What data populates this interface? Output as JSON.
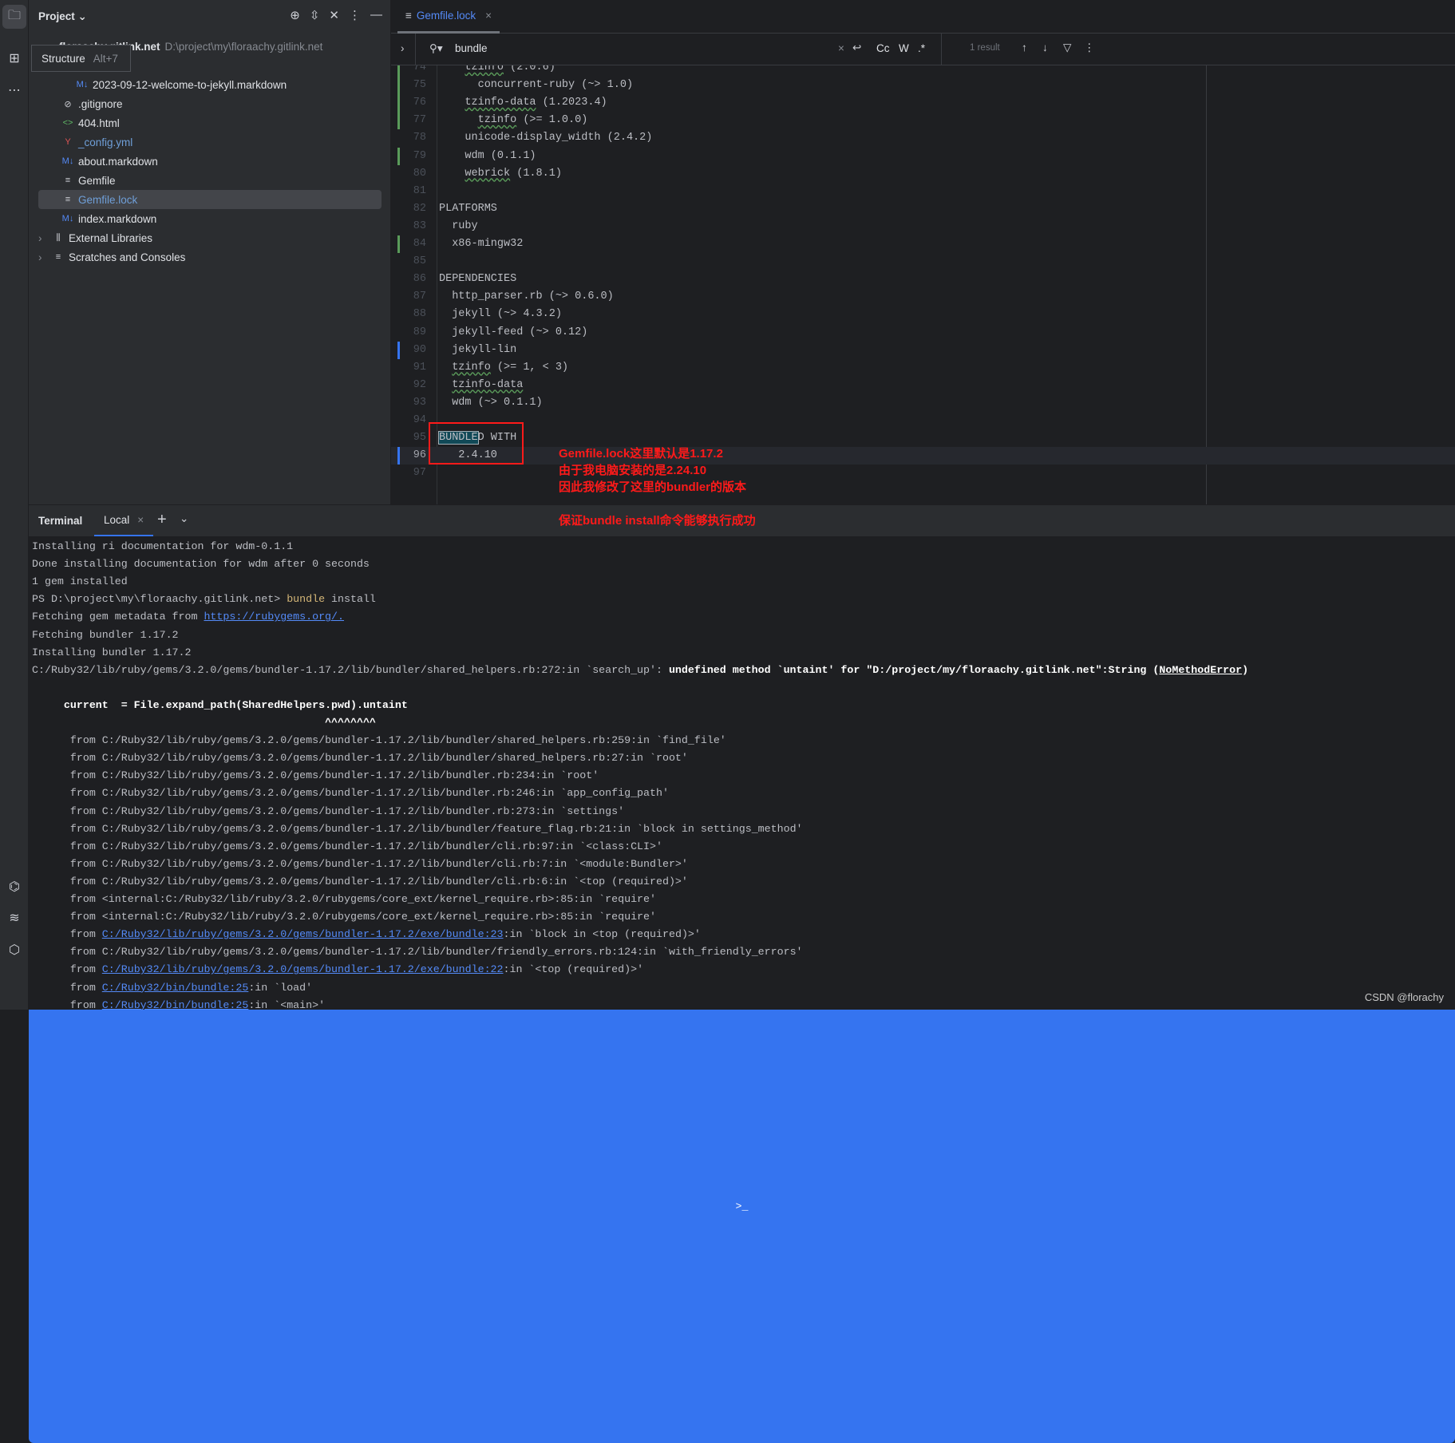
{
  "sidebar_strip": {
    "top": [
      {
        "icon": "folder-icon"
      },
      {
        "icon": "structure-icon"
      },
      {
        "icon": "more-icon"
      }
    ],
    "bottom": [
      {
        "icon": "python-icon"
      },
      {
        "icon": "layers-icon"
      },
      {
        "icon": "run-icon"
      },
      {
        "icon": "terminal-icon"
      }
    ]
  },
  "tooltip": {
    "label": "Structure",
    "shortcut": "Alt+7"
  },
  "project": {
    "title": "Project",
    "root": {
      "name": "floraachy.gitlink.net",
      "path": "D:\\project\\my\\floraachy.gitlink.net"
    },
    "items": [
      {
        "label": "2023-09-12-welcome-to-jekyll.markdown",
        "icon": "M↓",
        "indent": 3,
        "color": "#dfe1e5"
      },
      {
        "label": ".gitignore",
        "icon": "⊘",
        "indent": 2,
        "color": "#dfe1e5"
      },
      {
        "label": "404.html",
        "icon": "<>",
        "indent": 2,
        "color": "#dfe1e5"
      },
      {
        "label": "_config.yml",
        "icon": "Y",
        "indent": 2,
        "color": "#6f9fd8"
      },
      {
        "label": "about.markdown",
        "icon": "M↓",
        "indent": 2,
        "color": "#dfe1e5"
      },
      {
        "label": "Gemfile",
        "icon": "≡",
        "indent": 2,
        "color": "#dfe1e5"
      },
      {
        "label": "Gemfile.lock",
        "icon": "≡",
        "indent": 2,
        "color": "#6f9fd8",
        "selected": true
      },
      {
        "label": "index.markdown",
        "icon": "M↓",
        "indent": 2,
        "color": "#dfe1e5"
      },
      {
        "label": "External Libraries",
        "icon": "⫼",
        "indent": 1,
        "color": "#dfe1e5",
        "expandable": true
      },
      {
        "label": "Scratches and Consoles",
        "icon": "≡",
        "indent": 1,
        "color": "#dfe1e5",
        "expandable": true
      }
    ]
  },
  "tab": {
    "label": "Gemfile.lock"
  },
  "search": {
    "query": "bundle",
    "result": "1 result",
    "options": [
      "Cc",
      "W",
      ".*"
    ]
  },
  "editor": {
    "lines": [
      {
        "n": "74",
        "chg": "#5a9b5a",
        "s": [
          [
            "    "
          ],
          [
            "tzinfo",
            "typo"
          ],
          [
            " (2.0.6)"
          ]
        ]
      },
      {
        "n": "75",
        "chg": "#5a9b5a",
        "s": [
          [
            "      concurrent-ruby (~> 1.0)"
          ]
        ]
      },
      {
        "n": "76",
        "chg": "#5a9b5a",
        "s": [
          [
            "    "
          ],
          [
            "tzinfo-data",
            "typo"
          ],
          [
            " (1.2023.4)"
          ]
        ]
      },
      {
        "n": "77",
        "chg": "#5a9b5a",
        "s": [
          [
            "      "
          ],
          [
            "tzinfo",
            "typo"
          ],
          [
            " (>= 1.0.0)"
          ]
        ]
      },
      {
        "n": "78",
        "s": [
          [
            "    unicode-display_width (2.4.2)"
          ]
        ]
      },
      {
        "n": "79",
        "chg": "#5a9b5a",
        "s": [
          [
            "    wdm (0.1.1)"
          ]
        ]
      },
      {
        "n": "80",
        "s": [
          [
            "    "
          ],
          [
            "webrick",
            "typo"
          ],
          [
            " (1.8.1)"
          ]
        ]
      },
      {
        "n": "81",
        "s": [
          [
            ""
          ]
        ]
      },
      {
        "n": "82",
        "s": [
          [
            "PLATFORMS"
          ]
        ]
      },
      {
        "n": "83",
        "s": [
          [
            "  ruby"
          ]
        ]
      },
      {
        "n": "84",
        "chg": "#5a9b5a",
        "s": [
          [
            "  x86-mingw32"
          ]
        ]
      },
      {
        "n": "85",
        "s": [
          [
            ""
          ]
        ]
      },
      {
        "n": "86",
        "s": [
          [
            "DEPENDENCIES"
          ]
        ]
      },
      {
        "n": "87",
        "s": [
          [
            "  http_parser.rb (~> 0.6.0)"
          ]
        ]
      },
      {
        "n": "88",
        "s": [
          [
            "  jekyll (~> 4.3.2)"
          ]
        ]
      },
      {
        "n": "89",
        "s": [
          [
            "  jekyll-feed (~> 0.12)"
          ]
        ]
      },
      {
        "n": "90",
        "chg": "#3574f0",
        "s": [
          [
            "  jekyll-lin"
          ]
        ]
      },
      {
        "n": "91",
        "s": [
          [
            "  "
          ],
          [
            "tzinfo",
            "typo"
          ],
          [
            " (>= 1, < 3)"
          ]
        ]
      },
      {
        "n": "92",
        "s": [
          [
            "  "
          ],
          [
            "tzinfo-data",
            "typo"
          ]
        ]
      },
      {
        "n": "93",
        "s": [
          [
            "  wdm (~> 0.1.1)"
          ]
        ]
      },
      {
        "n": "94",
        "s": [
          [
            ""
          ]
        ]
      },
      {
        "n": "95",
        "s": [
          [
            "BUNDLE",
            "hit"
          ],
          [
            "D WITH"
          ]
        ]
      },
      {
        "n": "96",
        "chg": "#3574f0",
        "cur": true,
        "s": [
          [
            "   2.4.10"
          ]
        ]
      },
      {
        "n": "97",
        "s": [
          [
            ""
          ]
        ]
      }
    ]
  },
  "annotations": [
    "Gemfile.lock这里默认是1.17.2",
    "由于我电脑安装的是2.24.10",
    "因此我修改了这里的bundler的版本",
    "保证bundle install命令能够执行成功"
  ],
  "terminal": {
    "title": "Terminal",
    "tab": "Local",
    "lines": [
      [
        [
          "Installing ri documentation for wdm-0.1.1"
        ]
      ],
      [
        [
          "Done installing documentation for wdm after 0 seconds"
        ]
      ],
      [
        [
          "1 gem installed"
        ]
      ],
      [
        [
          "PS D:\\project\\my\\floraachy.gitlink.net> "
        ],
        [
          "bundle",
          "yellow"
        ],
        [
          " install"
        ]
      ],
      [
        [
          "Fetching gem metadata from "
        ],
        [
          "https://rubygems.org/.",
          "link"
        ]
      ],
      [
        [
          "Fetching bundler 1.17.2"
        ]
      ],
      [
        [
          "Installing bundler 1.17.2"
        ]
      ],
      [
        [
          "C:/Ruby32/lib/ruby/gems/3.2.0/gems/bundler-1.17.2/lib/bundler/shared_helpers.rb:272:in `search_up': "
        ],
        [
          "undefined method `untaint' for \"D:/project/my/floraachy.gitlink.net\":String (",
          "bold"
        ],
        [
          "NoMethodError",
          "err"
        ],
        [
          ")",
          "bold"
        ]
      ],
      [
        [
          ""
        ]
      ],
      [
        [
          "     "
        ],
        [
          "current  = File.expand_path(SharedHelpers.pwd).untaint",
          "bold"
        ]
      ],
      [
        [
          "                                              "
        ],
        [
          "^^^^^^^^",
          "bold"
        ]
      ],
      [
        [
          "\tfrom C:/Ruby32/lib/ruby/gems/3.2.0/gems/bundler-1.17.2/lib/bundler/shared_helpers.rb:259:in `find_file'"
        ]
      ],
      [
        [
          "\tfrom C:/Ruby32/lib/ruby/gems/3.2.0/gems/bundler-1.17.2/lib/bundler/shared_helpers.rb:27:in `root'"
        ]
      ],
      [
        [
          "\tfrom C:/Ruby32/lib/ruby/gems/3.2.0/gems/bundler-1.17.2/lib/bundler.rb:234:in `root'"
        ]
      ],
      [
        [
          "\tfrom C:/Ruby32/lib/ruby/gems/3.2.0/gems/bundler-1.17.2/lib/bundler.rb:246:in `app_config_path'"
        ]
      ],
      [
        [
          "\tfrom C:/Ruby32/lib/ruby/gems/3.2.0/gems/bundler-1.17.2/lib/bundler.rb:273:in `settings'"
        ]
      ],
      [
        [
          "\tfrom C:/Ruby32/lib/ruby/gems/3.2.0/gems/bundler-1.17.2/lib/bundler/feature_flag.rb:21:in `block in settings_method'"
        ]
      ],
      [
        [
          "\tfrom C:/Ruby32/lib/ruby/gems/3.2.0/gems/bundler-1.17.2/lib/bundler/cli.rb:97:in `<class:CLI>'"
        ]
      ],
      [
        [
          "\tfrom C:/Ruby32/lib/ruby/gems/3.2.0/gems/bundler-1.17.2/lib/bundler/cli.rb:7:in `<module:Bundler>'"
        ]
      ],
      [
        [
          "\tfrom C:/Ruby32/lib/ruby/gems/3.2.0/gems/bundler-1.17.2/lib/bundler/cli.rb:6:in `<top (required)>'"
        ]
      ],
      [
        [
          "\tfrom <internal:C:/Ruby32/lib/ruby/3.2.0/rubygems/core_ext/kernel_require.rb>:85:in `require'"
        ]
      ],
      [
        [
          "\tfrom <internal:C:/Ruby32/lib/ruby/3.2.0/rubygems/core_ext/kernel_require.rb>:85:in `require'"
        ]
      ],
      [
        [
          "\tfrom "
        ],
        [
          "C:/Ruby32/lib/ruby/gems/3.2.0/gems/bundler-1.17.2/exe/bundle:23",
          "link"
        ],
        [
          ":in `block in <top (required)>'"
        ]
      ],
      [
        [
          "\tfrom C:/Ruby32/lib/ruby/gems/3.2.0/gems/bundler-1.17.2/lib/bundler/friendly_errors.rb:124:in `with_friendly_errors'"
        ]
      ],
      [
        [
          "\tfrom "
        ],
        [
          "C:/Ruby32/lib/ruby/gems/3.2.0/gems/bundler-1.17.2/exe/bundle:22",
          "link"
        ],
        [
          ":in `<top (required)>'"
        ]
      ],
      [
        [
          "\tfrom "
        ],
        [
          "C:/Ruby32/bin/bundle:25",
          "link"
        ],
        [
          ":in `load'"
        ]
      ],
      [
        [
          "\tfrom "
        ],
        [
          "C:/Ruby32/bin/bundle:25",
          "link"
        ],
        [
          ":in `<main>'"
        ]
      ]
    ]
  },
  "watermark": "CSDN @florachy"
}
